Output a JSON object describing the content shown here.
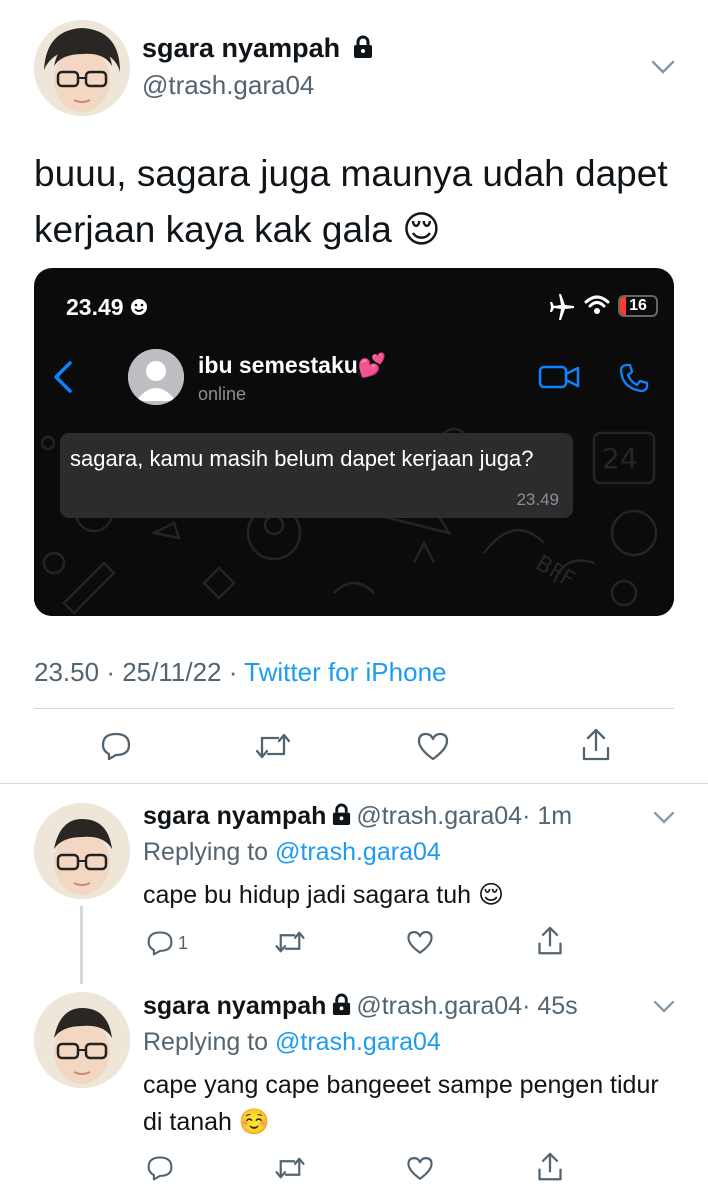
{
  "main_tweet": {
    "display_name": "sgara nyampah",
    "handle": "@trash.gara04",
    "text": "buuu, sagara juga maunya udah dapet kerjaan kaya kak gala",
    "emoji": "😌",
    "time": "23.50",
    "date": "25/11/22",
    "source": "Twitter for iPhone",
    "separator": "·"
  },
  "whatsapp": {
    "status_bar_time": "23.49",
    "battery": "16",
    "contact_name": "ibu semestaku",
    "contact_emoji": "💕",
    "contact_status": "online",
    "message": "sagara, kamu masih belum dapet kerjaan juga?",
    "message_time": "23.49",
    "pattern_label": "24",
    "pattern_label_2": "BFF"
  },
  "replies": [
    {
      "display_name": "sgara nyampah",
      "handle": "@trash.gara04",
      "time": "· 1m",
      "replying_prefix": "Replying to",
      "replying_to": "@trash.gara04",
      "text": "cape bu hidup jadi sagara tuh",
      "emoji": "😌",
      "reply_count": "1"
    },
    {
      "display_name": "sgara nyampah",
      "handle": "@trash.gara04",
      "time": "· 45s",
      "replying_prefix": "Replying to",
      "replying_to": "@trash.gara04",
      "text": "cape yang cape bangeeet sampe pengen tidur di tanah",
      "emoji": "☺️",
      "reply_count": ""
    }
  ],
  "colors": {
    "accent": "#1d9bf0",
    "secondary_text": "#536471",
    "whatsapp_blue": "#0a84ff",
    "bubble": "#2c2c2e",
    "battery_red": "#ff3b30"
  }
}
